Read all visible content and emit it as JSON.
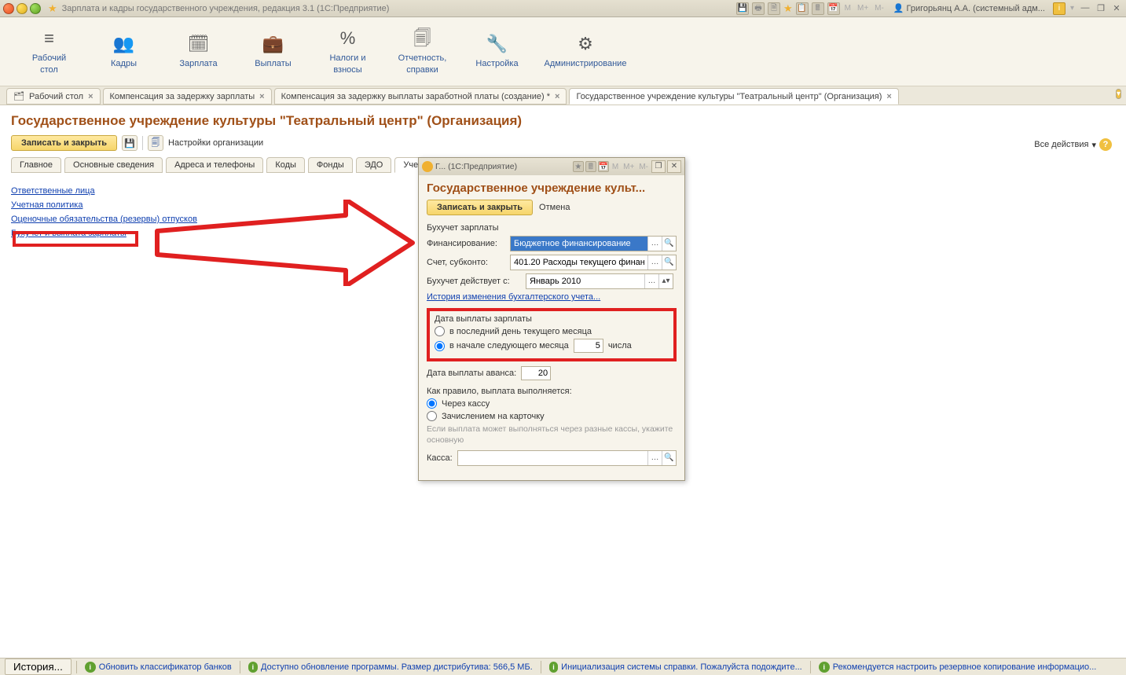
{
  "titlebar": {
    "title": "Зарплата и кадры государственного учреждения, редакция 3.1  (1С:Предприятие)",
    "user": "Григорьянц А.А. (системный адм...",
    "m_labels": [
      "M",
      "M+",
      "M-"
    ]
  },
  "main_nav": [
    {
      "label": "Рабочий\nстол",
      "icon": "≡"
    },
    {
      "label": "Кадры",
      "icon": "👥"
    },
    {
      "label": "Зарплата",
      "icon": "🗓"
    },
    {
      "label": "Выплаты",
      "icon": "💼"
    },
    {
      "label": "Налоги и\nвзносы",
      "icon": "%"
    },
    {
      "label": "Отчетность,\nсправки",
      "icon": "🗐"
    },
    {
      "label": "Настройка",
      "icon": "🔧"
    },
    {
      "label": "Администрирование",
      "icon": "⚙"
    }
  ],
  "tabs": [
    {
      "label": "Рабочий стол",
      "icon": "🗂",
      "close": true
    },
    {
      "label": "Компенсация за задержку зарплаты",
      "close": true
    },
    {
      "label": "Компенсация за задержку выплаты заработной платы (создание) *",
      "close": true
    },
    {
      "label": "Государственное учреждение культуры \"Театральный центр\" (Организация)",
      "close": true,
      "active": true
    }
  ],
  "page": {
    "title": "Государственное учреждение культуры \"Театральный центр\" (Организация)",
    "save_close": "Записать и закрыть",
    "org_settings": "Настройки организации",
    "all_actions": "Все действия"
  },
  "sub_tabs": [
    "Главное",
    "Основные сведения",
    "Адреса и телефоны",
    "Коды",
    "Фонды",
    "ЭДО",
    "Учетна"
  ],
  "links": [
    "Ответственные лица",
    "Учетная политика",
    "Оценочные обязательства (резервы) отпусков",
    "Бухучет и выплата зарплаты"
  ],
  "dialog": {
    "win_title": "Г...  (1С:Предприятие)",
    "heading": "Государственное учреждение культ...",
    "save_close": "Записать и закрыть",
    "cancel": "Отмена",
    "sect_buh": "Бухучет зарплаты",
    "financing_label": "Финансирование:",
    "financing_value": "Бюджетное финансирование",
    "account_label": "Счет, субконто:",
    "account_value": "401.20 Расходы текущего финансо",
    "eff_label": "Бухучет действует с:",
    "eff_value": "Январь 2010",
    "history_link": "История изменения бухгалтерского учета...",
    "sect_date": "Дата выплаты зарплаты",
    "radio_last": "в последний день текущего месяца",
    "radio_next": "в начале следующего месяца",
    "day_value": "5",
    "day_suffix": "числа",
    "advance_label": "Дата выплаты аванса:",
    "advance_value": "20",
    "payment_rule": "Как правило, выплата выполняется:",
    "radio_cash": "Через кассу",
    "radio_card": "Зачислением на карточку",
    "muted": "Если выплата может выполняться через разные кассы, укажите основную",
    "kassa_label": "Касса:",
    "kassa_value": ""
  },
  "status": {
    "history": "История...",
    "msg1": "Обновить классификатор банков",
    "msg2": "Доступно обновление программы. Размер дистрибутива: 566,5 МБ.",
    "msg3": "Инициализация системы справки. Пожалуйста подождите...",
    "msg4": "Рекомендуется настроить резервное копирование информацио..."
  }
}
